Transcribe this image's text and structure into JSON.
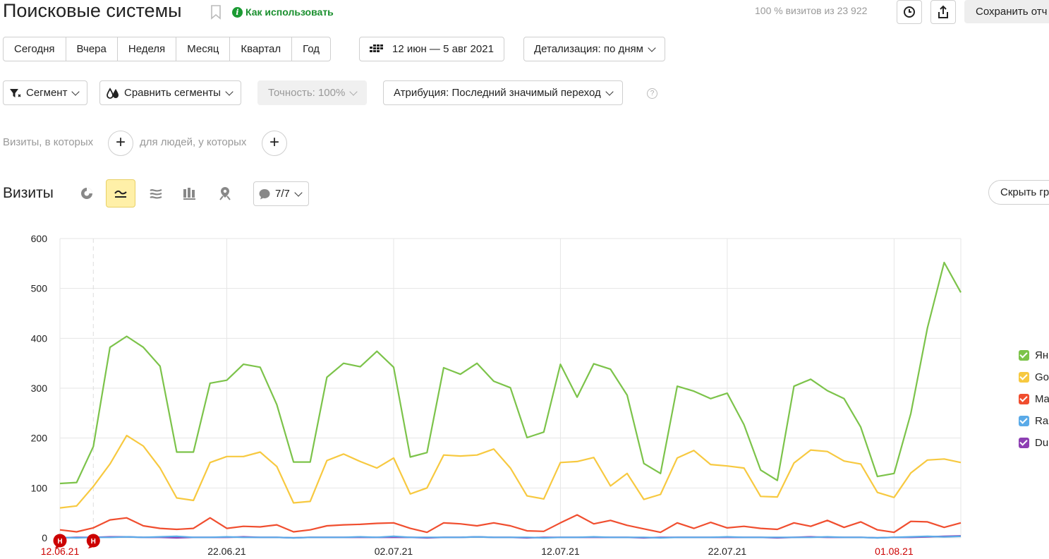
{
  "header": {
    "title": "Поисковые системы",
    "howto_label": "Как использовать",
    "visits_info": "100 % визитов из 23 922",
    "save_label": "Сохранить отч"
  },
  "periods": [
    "Сегодня",
    "Вчера",
    "Неделя",
    "Месяц",
    "Квартал",
    "Год"
  ],
  "date_range": "12 июн — 5 авг 2021",
  "detail": "Детализация: по дням",
  "filters": {
    "segment": "Сегмент",
    "compare": "Сравнить сегменты",
    "accuracy": "Точность: 100%",
    "attribution": "Атрибуция: Последний значимый переход",
    "help": "?"
  },
  "conditions": {
    "visits_where": "Визиты, в которых",
    "people_where": "для людей, у которых",
    "plus": "+"
  },
  "chart_header": {
    "title": "Визиты",
    "annotations_count": "7/7",
    "hide_label": "Скрыть гр"
  },
  "colors": {
    "yandex": "#7cc34a",
    "google": "#f7c940",
    "mail": "#f04e2f",
    "rambler": "#5aaae8",
    "duck": "#8d3fb3",
    "accent_red": "#cc0000",
    "green_link": "#1a8f2e"
  },
  "chart_data": {
    "type": "line",
    "ylabel": "",
    "xlabel": "",
    "ylim": [
      0,
      600
    ],
    "yticks": [
      0,
      100,
      200,
      300,
      400,
      500,
      600
    ],
    "x_start": "2021-06-12",
    "x_tick_labels": [
      {
        "index": 0,
        "label": "12.06.21",
        "weekend": true
      },
      {
        "index": 10,
        "label": "22.06.21",
        "weekend": false
      },
      {
        "index": 20,
        "label": "02.07.21",
        "weekend": false
      },
      {
        "index": 30,
        "label": "12.07.21",
        "weekend": false
      },
      {
        "index": 40,
        "label": "22.07.21",
        "weekend": false
      },
      {
        "index": 50,
        "label": "01.08.21",
        "weekend": true
      }
    ],
    "markers": [
      {
        "index": 0,
        "label": "Н"
      },
      {
        "index": 2,
        "label": "Н"
      }
    ],
    "legend": [
      "Ян",
      "Go",
      "Ma",
      "Ra",
      "Du"
    ],
    "series": [
      {
        "name": "Ян",
        "color": "#7cc34a",
        "values": [
          109,
          111,
          183,
          382,
          404,
          382,
          344,
          172,
          172,
          310,
          316,
          348,
          342,
          267,
          152,
          152,
          322,
          350,
          343,
          374,
          342,
          162,
          171,
          341,
          328,
          350,
          314,
          301,
          201,
          212,
          348,
          282,
          349,
          338,
          286,
          149,
          129,
          304,
          294,
          279,
          290,
          227,
          136,
          115,
          304,
          318,
          295,
          279,
          222,
          123,
          129,
          249,
          421,
          552,
          492
        ]
      },
      {
        "name": "Go",
        "color": "#f7c940",
        "values": [
          60,
          64,
          103,
          148,
          205,
          184,
          140,
          80,
          75,
          151,
          163,
          163,
          172,
          143,
          70,
          73,
          155,
          168,
          153,
          140,
          160,
          88,
          100,
          166,
          164,
          166,
          178,
          140,
          84,
          78,
          151,
          153,
          161,
          104,
          129,
          77,
          87,
          160,
          175,
          147,
          144,
          140,
          83,
          82,
          150,
          176,
          173,
          154,
          148,
          91,
          81,
          130,
          156,
          158,
          151
        ]
      },
      {
        "name": "Ma",
        "color": "#f04e2f",
        "values": [
          16,
          12,
          20,
          36,
          40,
          24,
          19,
          17,
          19,
          40,
          19,
          23,
          22,
          26,
          12,
          16,
          24,
          26,
          27,
          29,
          30,
          19,
          11,
          30,
          28,
          24,
          30,
          24,
          14,
          13,
          30,
          46,
          28,
          35,
          25,
          18,
          11,
          30,
          19,
          31,
          20,
          23,
          19,
          17,
          30,
          23,
          35,
          21,
          32,
          16,
          11,
          33,
          32,
          21,
          30
        ]
      },
      {
        "name": "Ra",
        "color": "#5aaae8",
        "values": [
          1,
          0,
          1,
          1,
          2,
          1,
          2,
          3,
          1,
          1,
          2,
          1,
          1,
          1,
          0,
          1,
          1,
          1,
          2,
          1,
          3,
          1,
          1,
          1,
          1,
          2,
          1,
          1,
          1,
          0,
          1,
          1,
          2,
          1,
          1,
          1,
          0,
          1,
          1,
          1,
          2,
          1,
          1,
          1,
          1,
          1,
          2,
          1,
          1,
          0,
          1,
          2,
          3,
          2,
          3
        ]
      },
      {
        "name": "Du",
        "color": "#8d3fb3",
        "values": [
          0,
          1,
          1,
          2,
          2,
          1,
          1,
          0,
          1,
          1,
          1,
          2,
          1,
          1,
          0,
          1,
          1,
          1,
          1,
          1,
          1,
          1,
          0,
          1,
          1,
          2,
          1,
          1,
          0,
          1,
          1,
          1,
          1,
          1,
          1,
          0,
          1,
          1,
          1,
          1,
          1,
          1,
          1,
          0,
          1,
          2,
          1,
          1,
          1,
          0,
          1,
          1,
          2,
          3,
          4
        ]
      }
    ]
  }
}
